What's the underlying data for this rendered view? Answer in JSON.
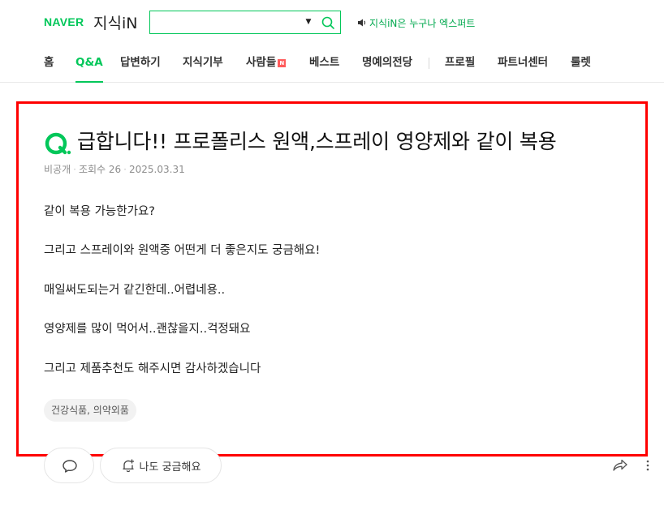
{
  "header": {
    "logo_naver": "NAVER",
    "logo_kin": "지식iN",
    "search": {
      "value": "",
      "placeholder": ""
    },
    "notice": "지식iN은 누구나 엑스퍼트"
  },
  "nav": {
    "items": [
      {
        "label": "홈",
        "active": false
      },
      {
        "label": "Q&A",
        "active": true
      },
      {
        "label": "답변하기",
        "active": false
      },
      {
        "label": "지식기부",
        "active": false
      },
      {
        "label": "사람들",
        "active": false,
        "badge": "N"
      },
      {
        "label": "베스트",
        "active": false
      },
      {
        "label": "명예의전당",
        "active": false
      },
      {
        "label": "프로필",
        "active": false
      },
      {
        "label": "파트너센터",
        "active": false
      },
      {
        "label": "룰렛",
        "active": false
      }
    ]
  },
  "question": {
    "q_mark": "Q.",
    "title": "급합니다!! 프로폴리스 원액,스프레이 영양제와 같이 복용",
    "meta": {
      "author": "비공개",
      "views": "조회수 26",
      "date": "2025.03.31"
    },
    "body": [
      "같이 복용 가능한가요?",
      "그리고 스프레이와 원액중 어떤게 더 좋은지도 궁금해요!",
      "매일써도되는거 같긴한데..어렵네용..",
      "영양제를 많이 먹어서..괜찮을지..걱정돼요",
      "그리고 제품추천도 해주시면 감사하겠습니다"
    ],
    "tag": "건강식품, 의약외품"
  },
  "actions": {
    "curious_label": "나도 궁금해요"
  },
  "colors": {
    "brand_green": "#03c75a",
    "highlight_red": "#ff0000"
  },
  "icons": [
    "search-icon",
    "chevron-down-icon",
    "speaker-icon",
    "comment-icon",
    "bell-plus-icon",
    "share-icon",
    "more-icon"
  ]
}
